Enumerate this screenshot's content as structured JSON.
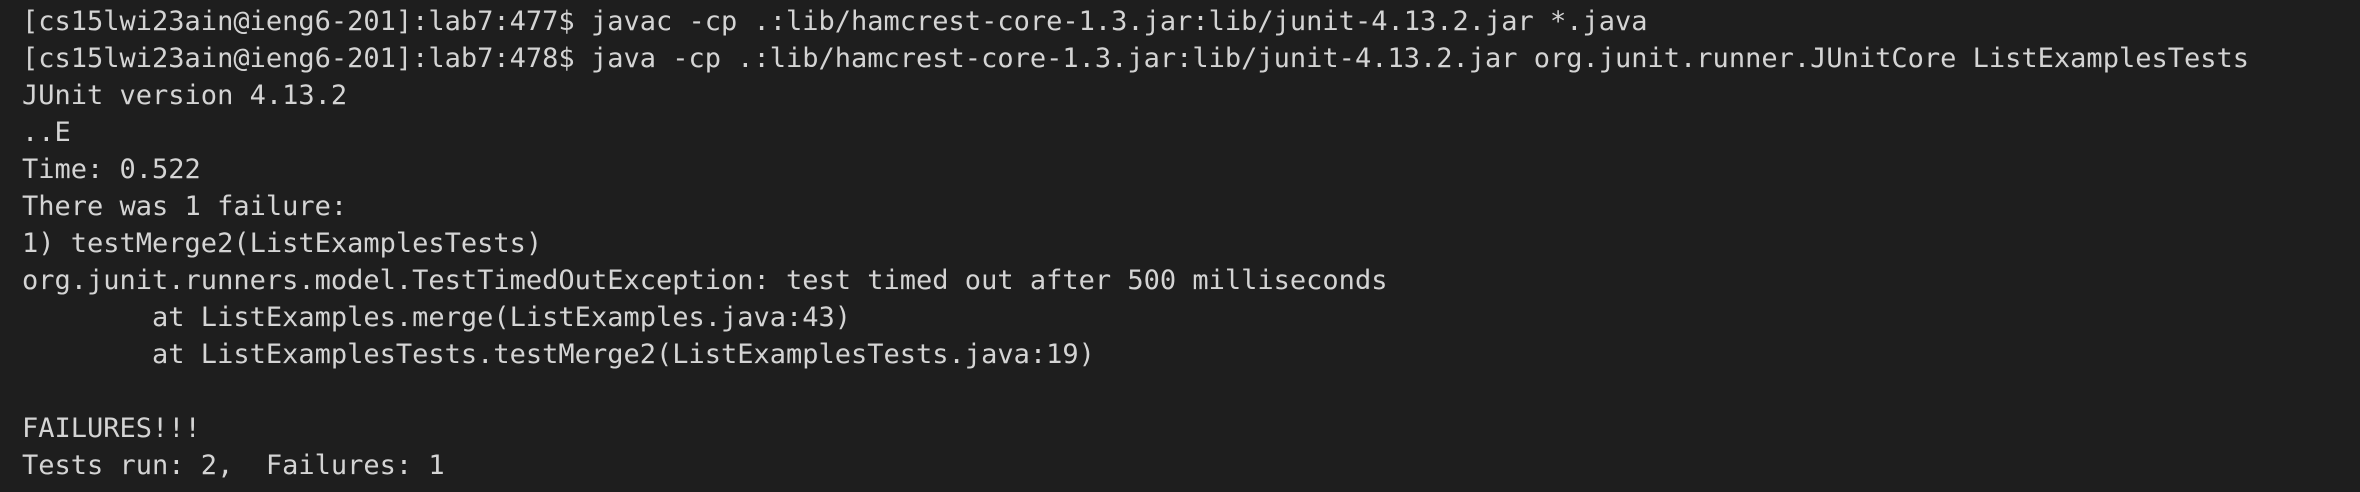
{
  "terminal": {
    "lines": [
      "[cs15lwi23ain@ieng6-201]:lab7:477$ javac -cp .:lib/hamcrest-core-1.3.jar:lib/junit-4.13.2.jar *.java",
      "[cs15lwi23ain@ieng6-201]:lab7:478$ java -cp .:lib/hamcrest-core-1.3.jar:lib/junit-4.13.2.jar org.junit.runner.JUnitCore ListExamplesTests",
      "JUnit version 4.13.2",
      "..E",
      "Time: 0.522",
      "There was 1 failure:",
      "1) testMerge2(ListExamplesTests)",
      "org.junit.runners.model.TestTimedOutException: test timed out after 500 milliseconds",
      "        at ListExamples.merge(ListExamples.java:43)",
      "        at ListExamplesTests.testMerge2(ListExamplesTests.java:19)",
      "",
      "FAILURES!!!",
      "Tests run: 2,  Failures: 1"
    ]
  }
}
